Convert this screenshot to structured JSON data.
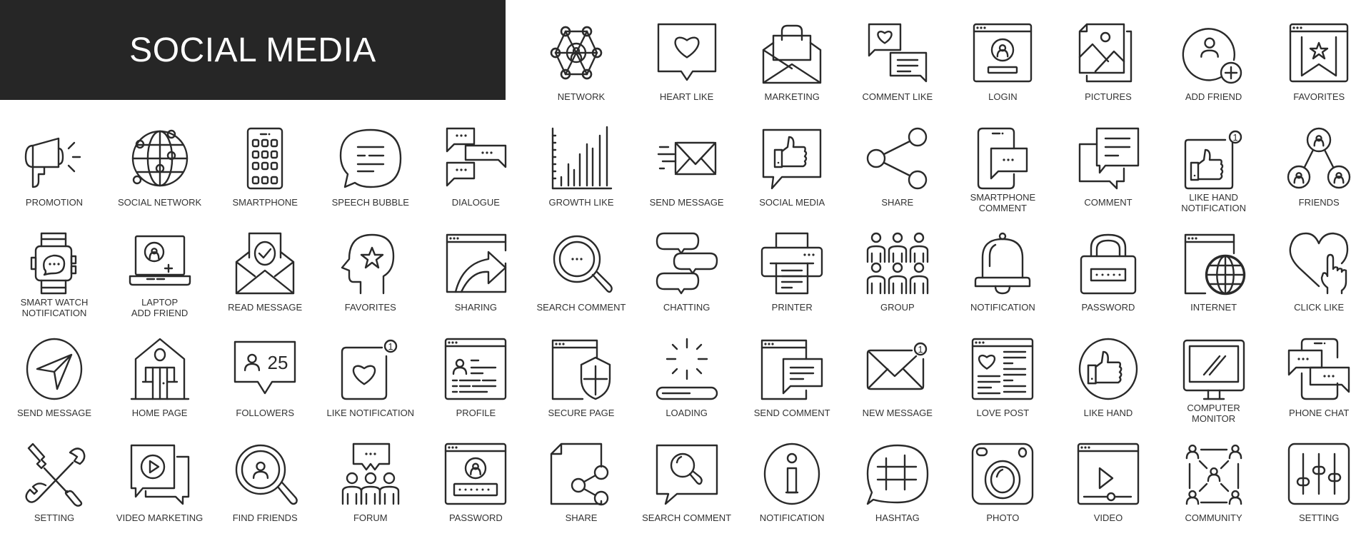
{
  "banner": {
    "title": "SOCIAL MEDIA",
    "background": "#262626",
    "text_color": "#ffffff"
  },
  "stroke_color": "#2a2a2a",
  "icons": [
    {
      "row": 0,
      "col": 5,
      "icon": "network",
      "label": [
        "NETWORK"
      ]
    },
    {
      "row": 0,
      "col": 6,
      "icon": "heart-like",
      "label": [
        "HEART LIKE"
      ]
    },
    {
      "row": 0,
      "col": 7,
      "icon": "marketing",
      "label": [
        "MARKETING"
      ]
    },
    {
      "row": 0,
      "col": 8,
      "icon": "comment-like",
      "label": [
        "COMMENT LIKE"
      ]
    },
    {
      "row": 0,
      "col": 9,
      "icon": "login",
      "label": [
        "LOGIN"
      ]
    },
    {
      "row": 0,
      "col": 10,
      "icon": "pictures",
      "label": [
        "PICTURES"
      ]
    },
    {
      "row": 0,
      "col": 11,
      "icon": "add-friend",
      "label": [
        "ADD FRIEND"
      ]
    },
    {
      "row": 0,
      "col": 12,
      "icon": "favorites-bookmark",
      "label": [
        "FAVORITES"
      ]
    },
    {
      "row": 1,
      "col": 0,
      "icon": "promotion",
      "label": [
        "PROMOTION"
      ]
    },
    {
      "row": 1,
      "col": 1,
      "icon": "social-network",
      "label": [
        "SOCIAL NETWORK"
      ]
    },
    {
      "row": 1,
      "col": 2,
      "icon": "smartphone",
      "label": [
        "SMARTPHONE"
      ]
    },
    {
      "row": 1,
      "col": 3,
      "icon": "speech-bubble",
      "label": [
        "SPEECH BUBBLE"
      ]
    },
    {
      "row": 1,
      "col": 4,
      "icon": "dialogue",
      "label": [
        "DIALOGUE"
      ]
    },
    {
      "row": 1,
      "col": 5,
      "icon": "growth-like",
      "label": [
        "GROWTH LIKE"
      ]
    },
    {
      "row": 1,
      "col": 6,
      "icon": "send-message-envelope",
      "label": [
        "SEND MESSAGE"
      ]
    },
    {
      "row": 1,
      "col": 7,
      "icon": "social-media",
      "label": [
        "SOCIAL MEDIA"
      ]
    },
    {
      "row": 1,
      "col": 8,
      "icon": "share",
      "label": [
        "SHARE"
      ]
    },
    {
      "row": 1,
      "col": 9,
      "icon": "smartphone-comment",
      "label": [
        "SMARTPHONE",
        "COMMENT"
      ]
    },
    {
      "row": 1,
      "col": 10,
      "icon": "comment",
      "label": [
        "COMMENT"
      ]
    },
    {
      "row": 1,
      "col": 11,
      "icon": "like-hand-notification",
      "label": [
        "LIKE HAND",
        "NOTIFICATION"
      ],
      "badge": "1"
    },
    {
      "row": 1,
      "col": 12,
      "icon": "friends",
      "label": [
        "FRIENDS"
      ]
    },
    {
      "row": 2,
      "col": 0,
      "icon": "smart-watch-notification",
      "label": [
        "SMART WATCH",
        "NOTIFICATION"
      ]
    },
    {
      "row": 2,
      "col": 1,
      "icon": "laptop-add-friend",
      "label": [
        "LAPTOP",
        "ADD FRIEND"
      ]
    },
    {
      "row": 2,
      "col": 2,
      "icon": "read-message",
      "label": [
        "READ MESSAGE"
      ]
    },
    {
      "row": 2,
      "col": 3,
      "icon": "favorites-head",
      "label": [
        "FAVORITES"
      ]
    },
    {
      "row": 2,
      "col": 4,
      "icon": "sharing",
      "label": [
        "SHARING"
      ]
    },
    {
      "row": 2,
      "col": 5,
      "icon": "search-comment",
      "label": [
        "SEARCH COMMENT"
      ]
    },
    {
      "row": 2,
      "col": 6,
      "icon": "chatting",
      "label": [
        "CHATTING"
      ]
    },
    {
      "row": 2,
      "col": 7,
      "icon": "printer",
      "label": [
        "PRINTER"
      ]
    },
    {
      "row": 2,
      "col": 8,
      "icon": "group",
      "label": [
        "GROUP"
      ]
    },
    {
      "row": 2,
      "col": 9,
      "icon": "notification-bell",
      "label": [
        "NOTIFICATION"
      ]
    },
    {
      "row": 2,
      "col": 10,
      "icon": "password-lock",
      "label": [
        "PASSWORD"
      ]
    },
    {
      "row": 2,
      "col": 11,
      "icon": "internet",
      "label": [
        "INTERNET"
      ]
    },
    {
      "row": 2,
      "col": 12,
      "icon": "click-like",
      "label": [
        "CLICK LIKE"
      ]
    },
    {
      "row": 3,
      "col": 0,
      "icon": "send-message-plane",
      "label": [
        "SEND MESSAGE"
      ]
    },
    {
      "row": 3,
      "col": 1,
      "icon": "home-page",
      "label": [
        "HOME PAGE"
      ]
    },
    {
      "row": 3,
      "col": 2,
      "icon": "followers",
      "label": [
        "FOLLOWERS"
      ],
      "count": "25"
    },
    {
      "row": 3,
      "col": 3,
      "icon": "like-notification",
      "label": [
        "LIKE NOTIFICATION"
      ],
      "badge": "1"
    },
    {
      "row": 3,
      "col": 4,
      "icon": "profile",
      "label": [
        "PROFILE"
      ]
    },
    {
      "row": 3,
      "col": 5,
      "icon": "secure-page",
      "label": [
        "SECURE PAGE"
      ]
    },
    {
      "row": 3,
      "col": 6,
      "icon": "loading",
      "label": [
        "LOADING"
      ]
    },
    {
      "row": 3,
      "col": 7,
      "icon": "send-comment",
      "label": [
        "SEND COMMENT"
      ]
    },
    {
      "row": 3,
      "col": 8,
      "icon": "new-message",
      "label": [
        "NEW MESSAGE"
      ],
      "badge": "1"
    },
    {
      "row": 3,
      "col": 9,
      "icon": "love-post",
      "label": [
        "LOVE POST"
      ]
    },
    {
      "row": 3,
      "col": 10,
      "icon": "like-hand",
      "label": [
        "LIKE HAND"
      ]
    },
    {
      "row": 3,
      "col": 11,
      "icon": "computer-monitor",
      "label": [
        "COMPUTER",
        "MONITOR"
      ]
    },
    {
      "row": 3,
      "col": 12,
      "icon": "phone-chat",
      "label": [
        "PHONE CHAT"
      ]
    },
    {
      "row": 4,
      "col": 0,
      "icon": "setting-tools",
      "label": [
        "SETTING"
      ]
    },
    {
      "row": 4,
      "col": 1,
      "icon": "video-marketing",
      "label": [
        "VIDEO MARKETING"
      ]
    },
    {
      "row": 4,
      "col": 2,
      "icon": "find-friends",
      "label": [
        "FIND FRIENDS"
      ]
    },
    {
      "row": 4,
      "col": 3,
      "icon": "forum",
      "label": [
        "FORUM"
      ]
    },
    {
      "row": 4,
      "col": 4,
      "icon": "password-page",
      "label": [
        "PASSWORD"
      ]
    },
    {
      "row": 4,
      "col": 5,
      "icon": "share-file",
      "label": [
        "SHARE"
      ]
    },
    {
      "row": 4,
      "col": 6,
      "icon": "search-comment-bubble",
      "label": [
        "SEARCH COMMENT"
      ]
    },
    {
      "row": 4,
      "col": 7,
      "icon": "info-notification",
      "label": [
        "NOTIFICATION"
      ]
    },
    {
      "row": 4,
      "col": 8,
      "icon": "hashtag",
      "label": [
        "HASHTAG"
      ]
    },
    {
      "row": 4,
      "col": 9,
      "icon": "photo",
      "label": [
        "PHOTO"
      ]
    },
    {
      "row": 4,
      "col": 10,
      "icon": "video",
      "label": [
        "VIDEO"
      ]
    },
    {
      "row": 4,
      "col": 11,
      "icon": "community",
      "label": [
        "COMMUNITY"
      ]
    },
    {
      "row": 4,
      "col": 12,
      "icon": "setting-sliders",
      "label": [
        "SETTING"
      ]
    }
  ]
}
